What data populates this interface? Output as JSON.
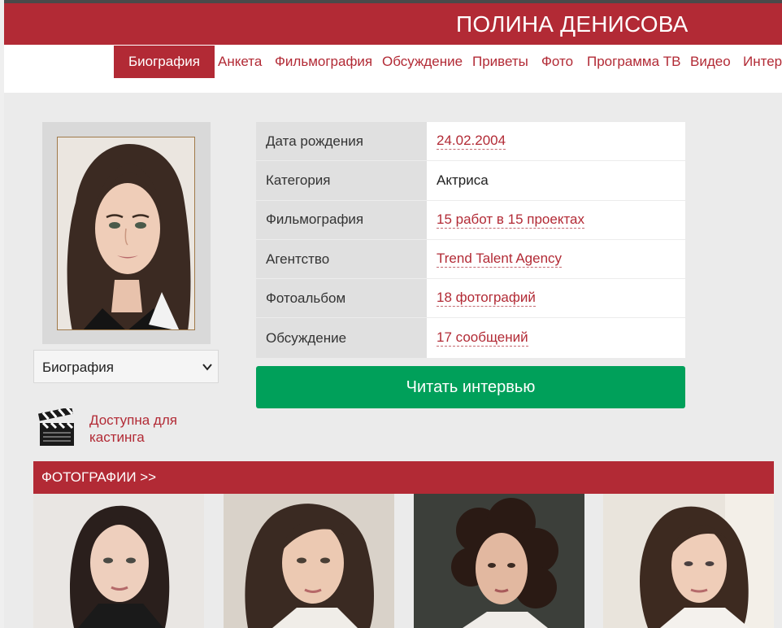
{
  "header": {
    "title": "ПОЛИНА ДЕНИСОВА"
  },
  "nav": {
    "tabs": [
      {
        "label": "Биография",
        "active": true
      },
      {
        "label": "Анкета"
      },
      {
        "label": "Фильмография"
      },
      {
        "label": "Обсуждение"
      },
      {
        "label": "Приветы"
      },
      {
        "label": "Фото"
      },
      {
        "label": "Программа ТВ"
      },
      {
        "label": "Видео"
      },
      {
        "label": "Интервью"
      }
    ]
  },
  "sidebar": {
    "select_value": "Биография",
    "casting_text": "Доступна для кастинга"
  },
  "info": {
    "rows": [
      {
        "key": "Дата рождения",
        "value": "24.02.2004",
        "link": true
      },
      {
        "key": "Категория",
        "value": "Актриса",
        "link": false
      },
      {
        "key": "Фильмография",
        "value": "15 работ в 15 проектах",
        "link": true
      },
      {
        "key": "Агентство",
        "value": "Trend Talent Agency",
        "link": true
      },
      {
        "key": "Фотоальбом",
        "value": "18 фотографий",
        "link": true
      },
      {
        "key": "Обсуждение",
        "value": "17 сообщений",
        "link": true
      }
    ]
  },
  "interview_button": "Читать интервью",
  "photos_section": {
    "title": "ФОТОГРАФИИ >>"
  },
  "colors": {
    "brand": "#b22a35",
    "button": "#00a05a",
    "background": "#ebebeb"
  }
}
